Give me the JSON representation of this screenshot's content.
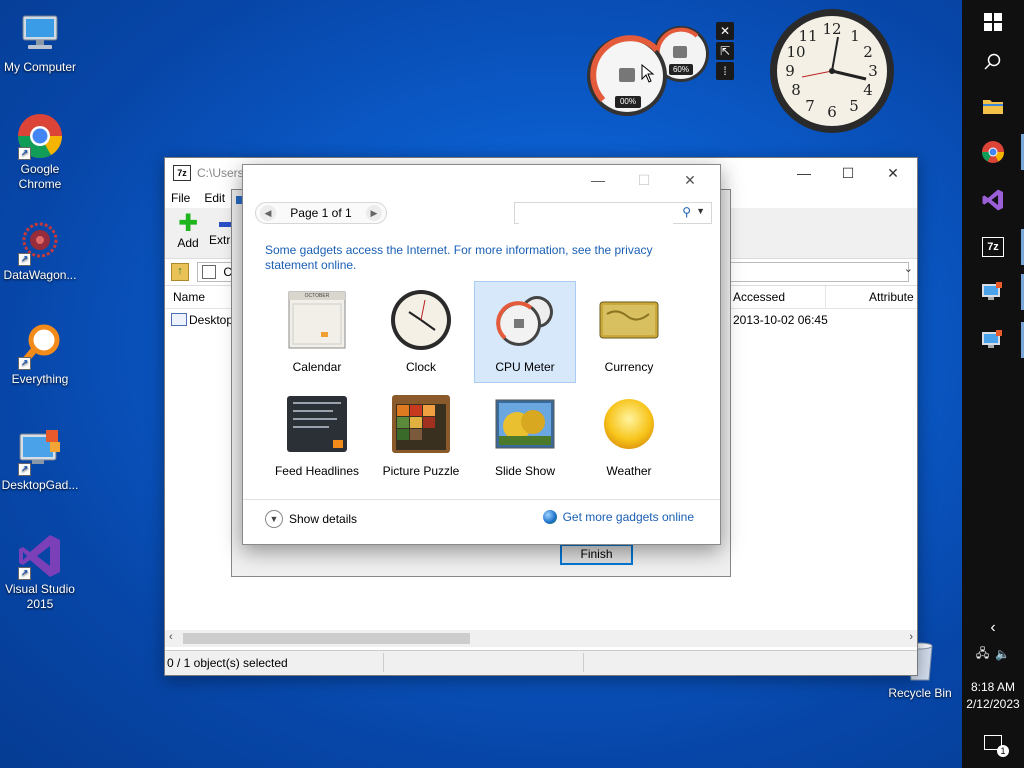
{
  "desktop": {
    "icons": [
      {
        "label": "My Computer"
      },
      {
        "label": "Google Chrome"
      },
      {
        "label": "DataWagon..."
      },
      {
        "label": "Everything"
      },
      {
        "label": "DesktopGad..."
      },
      {
        "label": "Visual Studio 2015"
      },
      {
        "label": "Recycle Bin"
      }
    ]
  },
  "gadgets": {
    "cpu_meter": {
      "cpu_percent": "00%",
      "memory_percent": "60%"
    },
    "controls": {
      "close": "✕",
      "resize": "⇱",
      "drag": "⁞"
    }
  },
  "taskbar": {
    "time": "8:18 AM",
    "date": "2/12/2023",
    "notification_count": "1",
    "seven_zip_label": "7z"
  },
  "zip_window": {
    "title": "C:\\Users\\",
    "menu": [
      "File",
      "Edit"
    ],
    "toolbar": {
      "add": "Add",
      "extract": "Extra"
    },
    "address": "C:",
    "columns": {
      "name": "Name",
      "accessed": "Accessed",
      "attributes": "Attribute"
    },
    "row": {
      "name": "Desktop",
      "accessed": "2013-10-02 06:45"
    },
    "status": "0 / 1 object(s) selected",
    "controls": {
      "minimize": "—",
      "maximize": "☐",
      "close": "✕"
    }
  },
  "extract_dialog": {
    "finish_label": "Finish"
  },
  "gallery": {
    "page_text": "Page 1 of 1",
    "search_placeholder": "",
    "notice": "Some gadgets access the Internet.  For more information, see the privacy statement online.",
    "gadgets": [
      {
        "label": "Calendar"
      },
      {
        "label": "Clock"
      },
      {
        "label": "CPU Meter"
      },
      {
        "label": "Currency"
      },
      {
        "label": "Feed Headlines"
      },
      {
        "label": "Picture Puzzle"
      },
      {
        "label": "Slide Show"
      },
      {
        "label": "Weather"
      }
    ],
    "selected": "CPU Meter",
    "calendar_month": "OCTOBER",
    "show_details": "Show details",
    "get_more": "Get more gadgets online",
    "controls": {
      "minimize": "—",
      "maximize": "☐",
      "close": "✕"
    }
  },
  "colors": {
    "accent": "#0078d7",
    "link": "#1a5fb4",
    "taskbar": "#101010"
  }
}
